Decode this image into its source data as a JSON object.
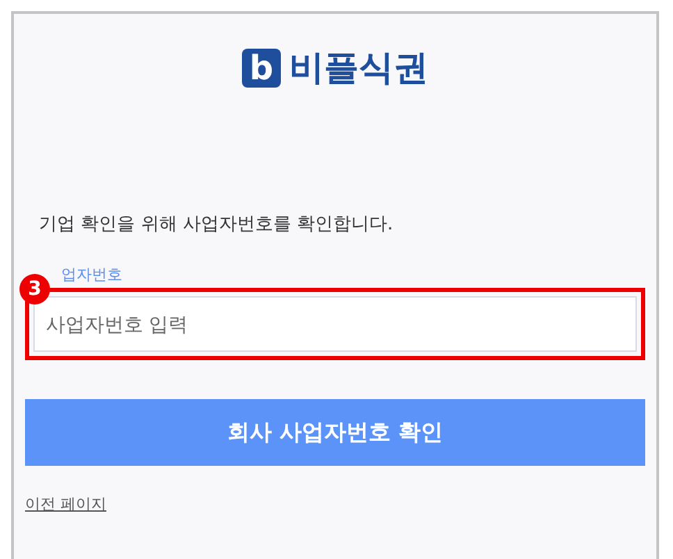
{
  "logo": {
    "mark": "b",
    "text": "비플식권"
  },
  "message": "기업 확인을 위해 사업자번호를 확인합니다.",
  "field": {
    "label": "업자번호",
    "placeholder": "사업자번호 입력",
    "highlighted": true,
    "step": "3"
  },
  "confirm_button": "회사 사업자번호 확인",
  "back_link": "이전 페이지"
}
